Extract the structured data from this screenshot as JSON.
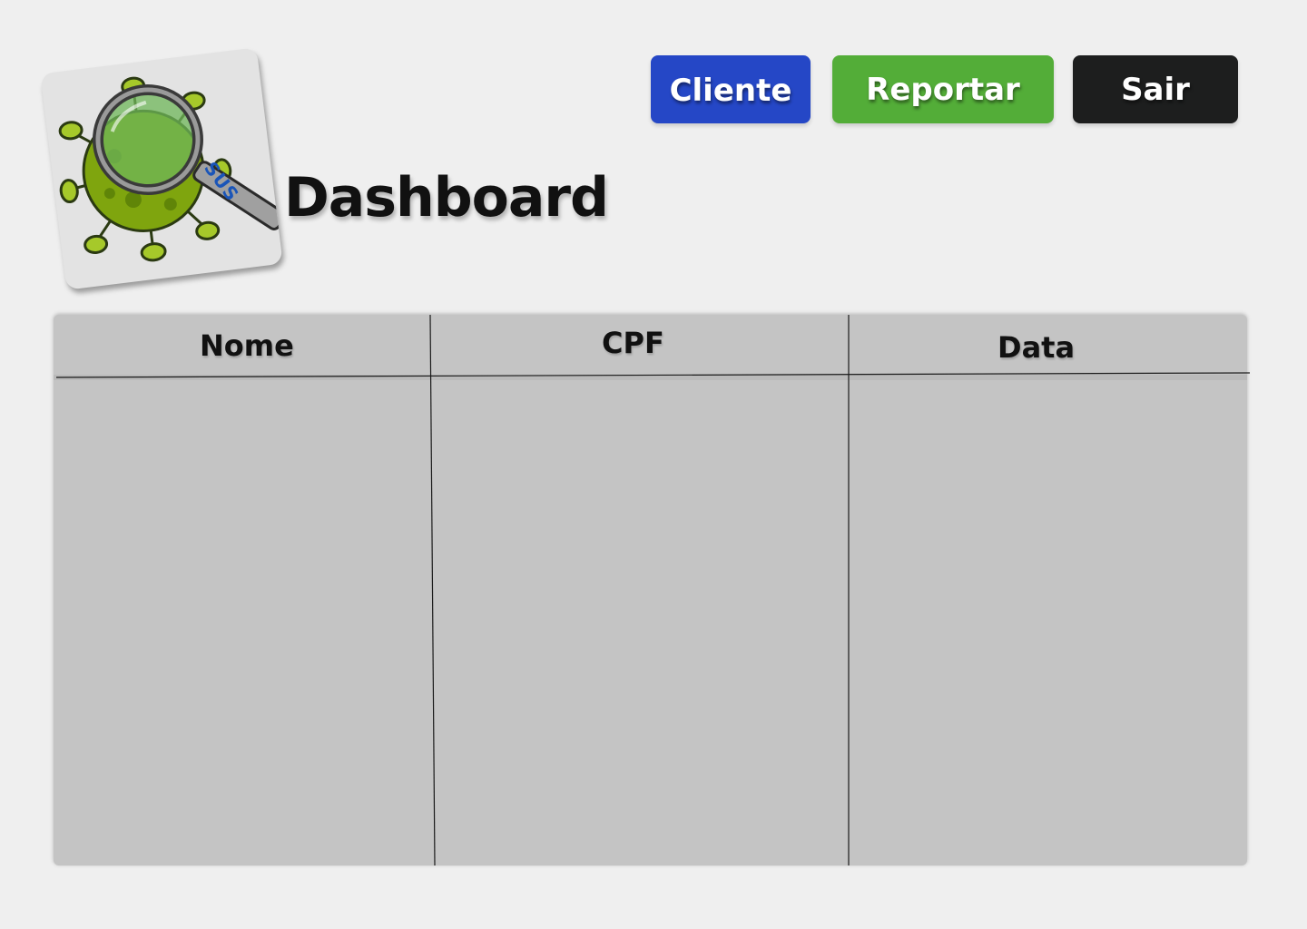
{
  "header": {
    "title": "Dashboard",
    "logo": {
      "icon": "virus-magnifier-logo-icon",
      "text": "SUS"
    }
  },
  "toolbar": {
    "cliente_label": "Cliente",
    "reportar_label": "Reportar",
    "sair_label": "Sair"
  },
  "colors": {
    "background": "#efefef",
    "cliente": "#2547c6",
    "reportar": "#53ad38",
    "sair": "#1d1e1e",
    "table": "#c4c4c4"
  },
  "table": {
    "columns": [
      "Nome",
      "CPF",
      "Data"
    ],
    "rows": []
  }
}
